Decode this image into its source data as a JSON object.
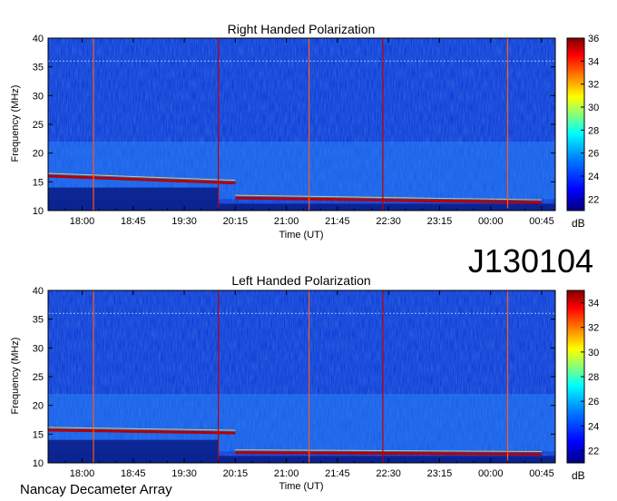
{
  "label_id": "J130104",
  "footer": "Nancay Decameter Array",
  "colors": {
    "background": "#ffffff",
    "spectrogram_base": "#0f3cd6",
    "spectrogram_bright": "#2a8cff",
    "emission_band": "#b40000",
    "colorbar_stops": [
      "#00007f",
      "#0000ff",
      "#007fff",
      "#00ffff",
      "#7fff7f",
      "#ffff00",
      "#ff7f00",
      "#ff0000",
      "#7f0000"
    ]
  },
  "chart_data": [
    {
      "type": "heatmap",
      "title": "Right Handed Polarization",
      "xlabel": "Time (UT)",
      "ylabel": "Frequency (MHz)",
      "x_tick_labels": [
        "18:00",
        "18:45",
        "19:30",
        "20:15",
        "21:00",
        "21:45",
        "22:30",
        "23:15",
        "00:00",
        "00:45"
      ],
      "y_ticks": [
        10,
        15,
        20,
        25,
        30,
        35,
        40
      ],
      "ylim": [
        10,
        40
      ],
      "colorbar": {
        "label": "dB",
        "ticks": [
          22,
          24,
          26,
          28,
          30,
          32,
          34,
          36
        ],
        "range": [
          21,
          36
        ]
      },
      "emission_bands": [
        {
          "start": "20:15",
          "end": "00:45",
          "freq_start": 12.2,
          "freq_end": 11.4,
          "level": 34
        },
        {
          "start": "17:30",
          "end": "20:15",
          "freq_start": 16.0,
          "freq_end": 14.8,
          "level": 30
        }
      ],
      "vertical_lines": [
        "18:10",
        "20:00",
        "21:20",
        "22:25",
        "00:15"
      ]
    },
    {
      "type": "heatmap",
      "title": "Left Handed Polarization",
      "xlabel": "Time (UT)",
      "ylabel": "Frequency (MHz)",
      "x_tick_labels": [
        "18:00",
        "18:45",
        "19:30",
        "20:15",
        "21:00",
        "21:45",
        "22:30",
        "23:15",
        "00:00",
        "00:45"
      ],
      "y_ticks": [
        10,
        15,
        20,
        25,
        30,
        35,
        40
      ],
      "ylim": [
        10,
        40
      ],
      "colorbar": {
        "label": "dB",
        "ticks": [
          22,
          24,
          26,
          28,
          30,
          32,
          34
        ],
        "range": [
          21,
          35
        ]
      },
      "emission_bands": [
        {
          "start": "20:15",
          "end": "00:45",
          "freq_start": 11.8,
          "freq_end": 11.5,
          "level": 33
        },
        {
          "start": "17:30",
          "end": "20:15",
          "freq_start": 15.7,
          "freq_end": 15.2,
          "level": 31
        }
      ],
      "vertical_lines": [
        "18:10",
        "20:00",
        "21:20",
        "22:25",
        "00:15"
      ]
    }
  ]
}
